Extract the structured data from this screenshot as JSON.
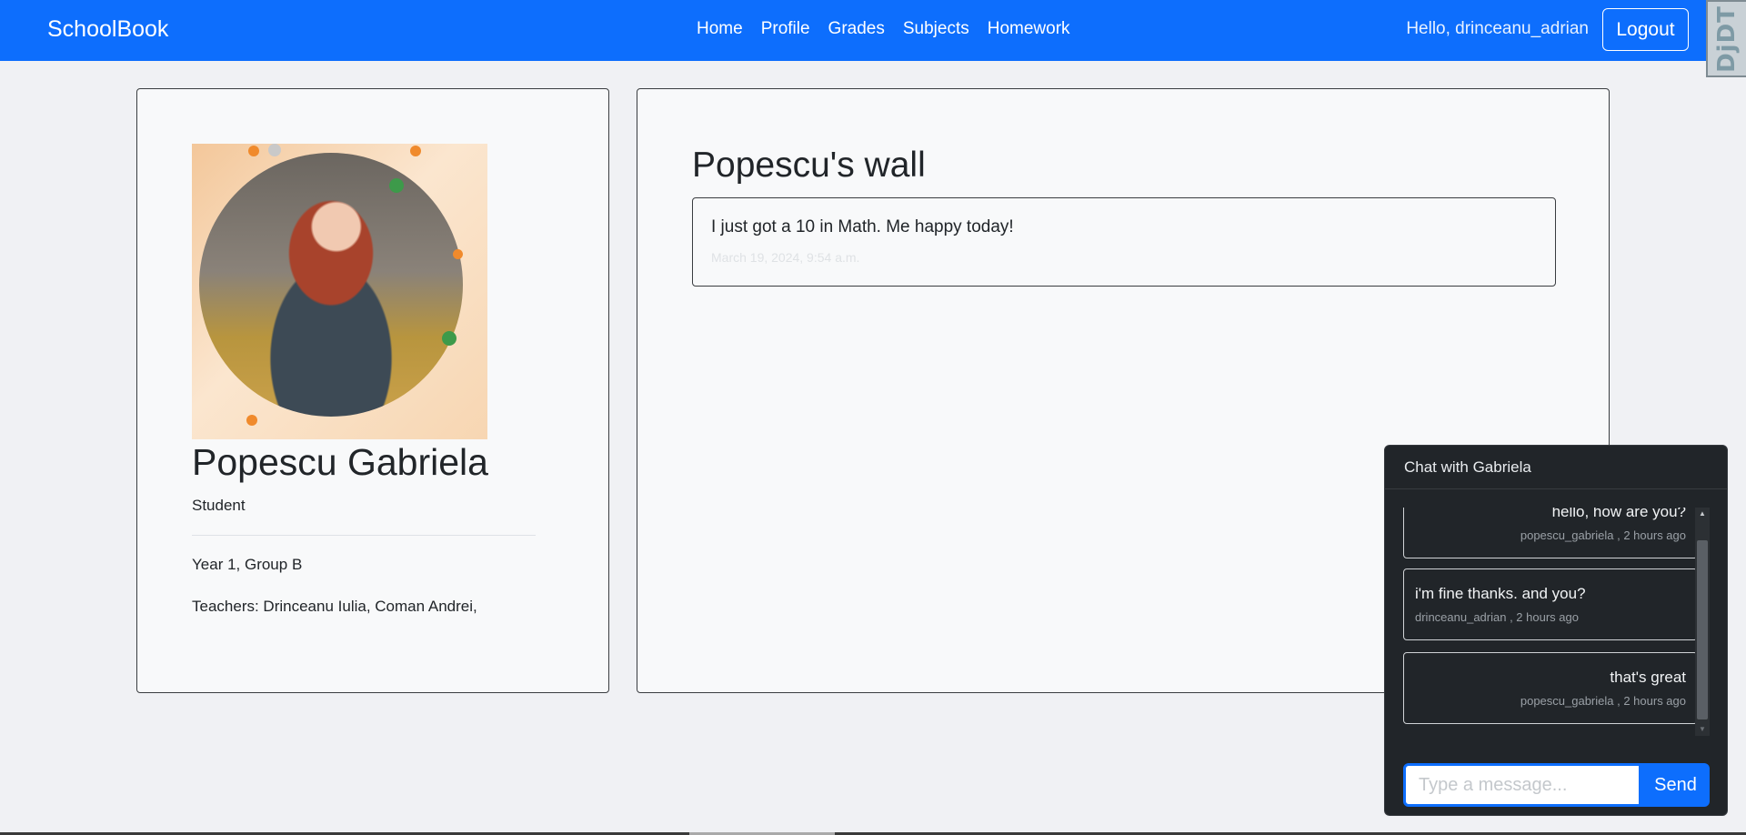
{
  "navbar": {
    "brand": "SchoolBook",
    "links": [
      "Home",
      "Profile",
      "Grades",
      "Subjects",
      "Homework"
    ],
    "greeting": "Hello, drinceanu_adrian",
    "logout_label": "Logout",
    "brand_color": "#0d6efd"
  },
  "debug_toolbar": {
    "label": "DjDT"
  },
  "profile": {
    "photo_alt": "profile-photo",
    "name": "Popescu Gabriela",
    "role": "Student",
    "year_group": "Year 1, Group B",
    "teachers": "Teachers: Drinceanu Iulia, Coman Andrei,"
  },
  "wall": {
    "title": "Popescu's wall",
    "posts": [
      {
        "text": "I just got a 10 in Math. Me happy today!",
        "date": "March 19, 2024, 9:54 a.m."
      }
    ]
  },
  "chat": {
    "title": "Chat with Gabriela",
    "messages": [
      {
        "text": "hello, how are you?",
        "meta": "popescu_gabriela , 2 hours ago",
        "side": "right"
      },
      {
        "text": "i'm fine thanks. and you?",
        "meta": "drinceanu_adrian , 2 hours ago",
        "side": "left"
      },
      {
        "text": "that's great",
        "meta": "popescu_gabriela , 2 hours ago",
        "side": "right"
      }
    ],
    "input_placeholder": "Type a message...",
    "input_value": "",
    "send_label": "Send"
  }
}
